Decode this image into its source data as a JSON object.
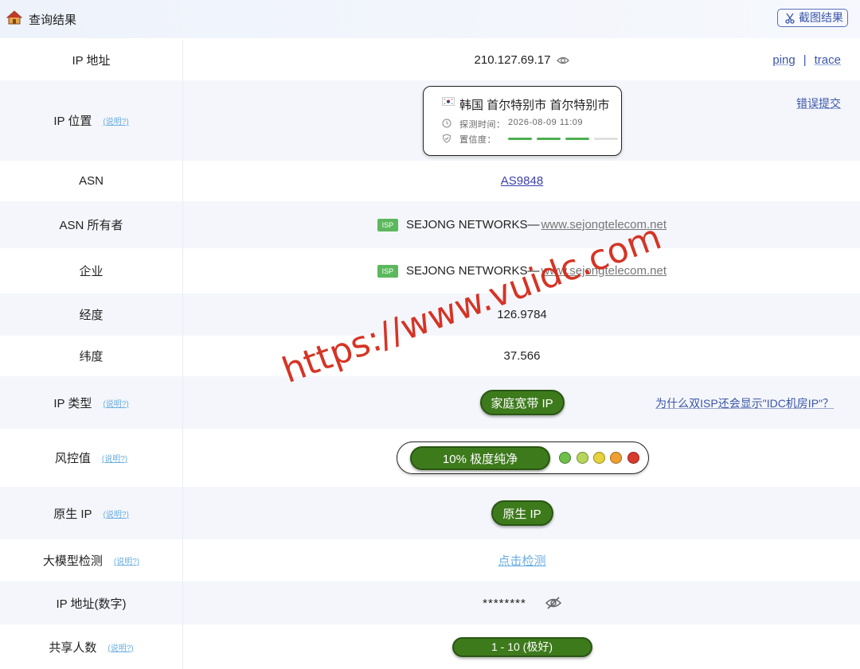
{
  "header": {
    "title": "查询结果",
    "screenshot_button": "截图结果",
    "home_icon": "home-icon",
    "screenshot_icon": "scissors-icon"
  },
  "rows": {
    "ip": {
      "label": "IP 地址",
      "value": "210.127.69.17",
      "ping": "ping",
      "sep": "|",
      "trace": "trace"
    },
    "location": {
      "label": "IP 位置",
      "note": "(说明?)",
      "place": "韩国 首尔特别市 首尔特别市",
      "detect_time_label": "探测时间：",
      "detect_time": "2026-08-09 11:09",
      "confidence_label": "置信度：",
      "confidence_segments": 4,
      "confidence_filled": 3,
      "error_link": "错误提交",
      "colors": {
        "filled": "#4caf50",
        "empty": "#e0e0e0"
      }
    },
    "asn": {
      "label": "ASN",
      "value": "AS9848"
    },
    "asn_owner": {
      "label": "ASN 所有者",
      "tag": "ISP",
      "name": "SEJONG NETWORKS—",
      "site": "www.sejongtelecom.net"
    },
    "company": {
      "label": "企业",
      "tag": "ISP",
      "name": "SEJONG NETWORKS—",
      "site": "www.sejongtelecom.net"
    },
    "longitude": {
      "label": "经度",
      "value": "126.9784"
    },
    "latitude": {
      "label": "纬度",
      "value": "37.566"
    },
    "ip_type": {
      "label": "IP 类型",
      "note": "(说明?)",
      "value": "家庭宽带 IP",
      "why_link": "为什么双ISP还会显示\"IDC机房IP\"？"
    },
    "risk": {
      "label": "风控值",
      "note": "(说明?)",
      "value": "10%  极度纯净",
      "dot_colors": [
        "#6cc04a",
        "#b5d65a",
        "#e6d23a",
        "#f0a030",
        "#d93a2b"
      ]
    },
    "native": {
      "label": "原生 IP",
      "note": "(说明?)",
      "value": "原生 IP"
    },
    "llm": {
      "label": "大模型检测",
      "note": "(说明?)",
      "value": "点击检测"
    },
    "ip_numeric": {
      "label": "IP 地址(数字)",
      "value": "********"
    },
    "shared": {
      "label": "共享人数",
      "note": "(说明?)",
      "value": "1 - 10 (极好)"
    }
  },
  "watermark": "https://www.vuidc.com",
  "colors": {
    "pill_green": "#3d7a1c",
    "link_blue": "#3b55a8",
    "note_blue": "#6aaee0",
    "alt_row": "#f4f6fb"
  }
}
